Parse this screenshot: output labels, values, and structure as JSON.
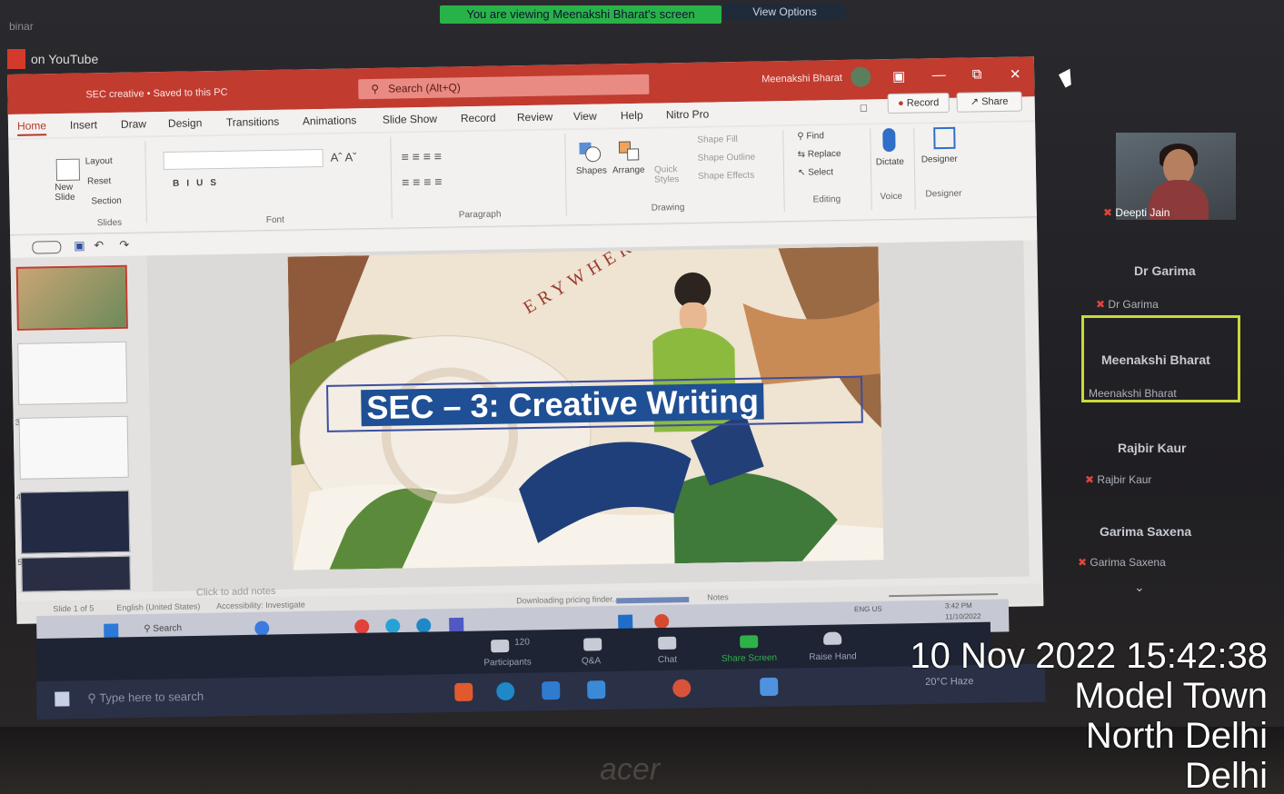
{
  "zoom": {
    "banner": "You are viewing Meenakshi Bharat's screen",
    "view_options": "View Options",
    "window_label": "binar",
    "youtube_label": "on YouTube"
  },
  "ppt": {
    "doc_title": "SEC creative • Saved to this PC",
    "search_placeholder": "Search (Alt+Q)",
    "user_name": "Meenakshi Bharat",
    "tabs": [
      "Home",
      "Insert",
      "Draw",
      "Design",
      "Transitions",
      "Animations",
      "Slide Show",
      "Record",
      "Review",
      "View",
      "Help",
      "Nitro Pro"
    ],
    "record_btn": "Record",
    "share_btn": "Share",
    "ribbon": {
      "layout": "Layout",
      "reset": "Reset",
      "section": "Section",
      "new_slide": "New Slide",
      "slides_group": "Slides",
      "font_group": "Font",
      "paragraph_group": "Paragraph",
      "shapes": "Shapes",
      "arrange": "Arrange",
      "quick_styles": "Quick Styles",
      "shape_fill": "Shape Fill",
      "shape_outline": "Shape Outline",
      "shape_effects": "Shape Effects",
      "drawing_group": "Drawing",
      "find": "Find",
      "replace": "Replace",
      "select": "Select",
      "editing_group": "Editing",
      "dictate": "Dictate",
      "voice_group": "Voice",
      "designer": "Designer",
      "designer_group": "Designer"
    },
    "slide_title": "SEC – 3: Creative Writing",
    "slide_arc_text": "ERYWHERE",
    "notes_placeholder": "Click to add notes",
    "thumb_numbers": [
      "3",
      "4",
      "5"
    ],
    "status": {
      "slide_count": "Slide 1 of 5",
      "language": "English (United States)",
      "accessibility": "Accessibility: Investigate",
      "downloading": "Downloading pricing finder...",
      "notes": "Notes"
    }
  },
  "participants": [
    {
      "name": "Deepti Jain",
      "sub": "Deepti Jain",
      "has_video": true
    },
    {
      "name": "Dr Garima",
      "sub": "Dr Garima"
    },
    {
      "name": "Meenakshi Bharat",
      "sub": "Meenakshi Bharat",
      "active": true
    },
    {
      "name": "Rajbir Kaur",
      "sub": "Rajbir Kaur"
    },
    {
      "name": "Garima Saxena",
      "sub": "Garima Saxena"
    }
  ],
  "zoom_toolbar": {
    "participants_count": "120",
    "participants": "Participants",
    "qa": "Q&A",
    "chat": "Chat",
    "share_screen": "Share Screen",
    "raise_hand": "Raise Hand"
  },
  "windows": {
    "search": "Search",
    "type_here": "Type here to search",
    "weather": "20°C Haze",
    "lang": "ENG US",
    "time": "3:42 PM",
    "date": "11/10/2022"
  },
  "laptop_brand": "acer",
  "overlay": {
    "datetime": "10 Nov 2022 15:42:38",
    "line2": "Model Town",
    "line3": "North Delhi",
    "line4": "Delhi"
  },
  "colors": {
    "ppt_red": "#c13b2f",
    "zoom_green": "#28b348",
    "active_speaker": "#c9d93a",
    "slide_title_bg": "#1f4f94"
  }
}
